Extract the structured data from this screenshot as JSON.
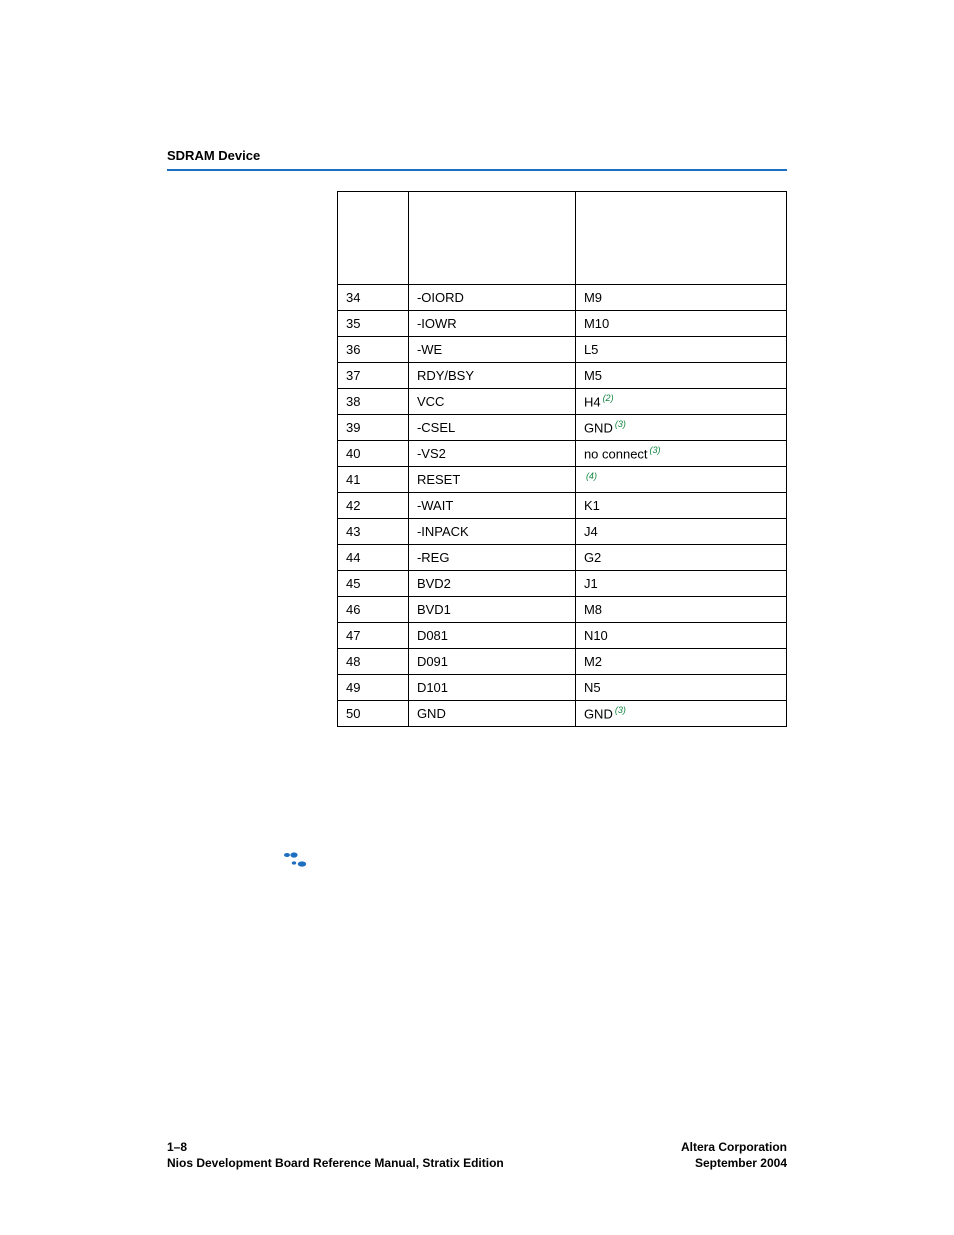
{
  "header": {
    "section": "SDRAM Device"
  },
  "table": {
    "headers": [
      "",
      "",
      ""
    ],
    "rows": [
      {
        "pin": "34",
        "name": "-OIORD",
        "conn": "M9",
        "note": ""
      },
      {
        "pin": "35",
        "name": "-IOWR",
        "conn": "M10",
        "note": ""
      },
      {
        "pin": "36",
        "name": "-WE",
        "conn": "L5",
        "note": ""
      },
      {
        "pin": "37",
        "name": "RDY/BSY",
        "conn": "M5",
        "note": ""
      },
      {
        "pin": "38",
        "name": "VCC",
        "conn": "H4",
        "note": "(2)"
      },
      {
        "pin": "39",
        "name": "-CSEL",
        "conn": "GND",
        "note": "(3)"
      },
      {
        "pin": "40",
        "name": "-VS2",
        "conn": "no connect",
        "note": "(3)"
      },
      {
        "pin": "41",
        "name": "RESET",
        "conn": "",
        "note": "(4)"
      },
      {
        "pin": "42",
        "name": "-WAIT",
        "conn": "K1",
        "note": ""
      },
      {
        "pin": "43",
        "name": "-INPACK",
        "conn": "J4",
        "note": ""
      },
      {
        "pin": "44",
        "name": "-REG",
        "conn": "G2",
        "note": ""
      },
      {
        "pin": "45",
        "name": "BVD2",
        "conn": "J1",
        "note": ""
      },
      {
        "pin": "46",
        "name": "BVD1",
        "conn": "M8",
        "note": ""
      },
      {
        "pin": "47",
        "name": "D081",
        "conn": "N10",
        "note": ""
      },
      {
        "pin": "48",
        "name": "D091",
        "conn": "M2",
        "note": ""
      },
      {
        "pin": "49",
        "name": "D101",
        "conn": "N5",
        "note": ""
      },
      {
        "pin": "50",
        "name": "GND",
        "conn": "GND",
        "note": "(3)"
      }
    ]
  },
  "footer": {
    "page_number": "1–8",
    "manual_title": "Nios Development Board Reference Manual, Stratix Edition",
    "corporation": "Altera Corporation",
    "date": "September 2004"
  }
}
